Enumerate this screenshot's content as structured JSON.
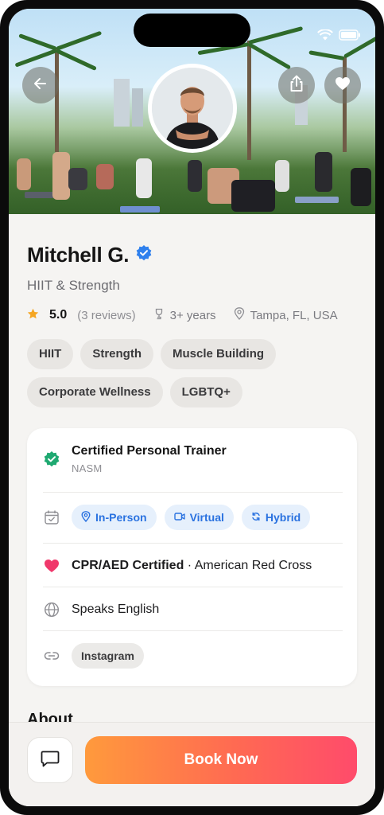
{
  "status_bar": {
    "time": "",
    "icons": [
      "wifi-icon",
      "battery-icon"
    ]
  },
  "hero": {
    "back_icon": "arrow-left-icon",
    "share_icon": "share-icon",
    "favorite_icon": "heart-icon"
  },
  "profile": {
    "name": "Mitchell G.",
    "verified_icon": "verified-badge-icon",
    "specialty": "HIIT & Strength",
    "rating": "5.0",
    "reviews": "(3 reviews)",
    "experience": "3+ years",
    "location": "Tampa, FL, USA"
  },
  "tags": [
    "HIIT",
    "Strength",
    "Muscle Building",
    "Corporate Wellness",
    "LGBTQ+"
  ],
  "details": {
    "certification": {
      "title": "Certified Personal Trainer",
      "issuer": "NASM"
    },
    "session_modes": [
      "In-Person",
      "Virtual",
      "Hybrid"
    ],
    "cpr": {
      "title": "CPR/AED Certified",
      "separator": " · ",
      "issuer": "American Red Cross"
    },
    "languages": "Speaks English",
    "links": [
      "Instagram"
    ]
  },
  "sections": {
    "about_title": "About"
  },
  "actions": {
    "book_label": "Book Now",
    "chat_icon": "chat-icon"
  },
  "colors": {
    "accent_blue": "#2a72e0",
    "verified_blue": "#2f80ed",
    "cert_green": "#1fa971",
    "heart_pink": "#f0386b",
    "star_orange": "#f5a623",
    "cta_gradient_start": "#ff9a3c",
    "cta_gradient_end": "#ff4b6b"
  }
}
